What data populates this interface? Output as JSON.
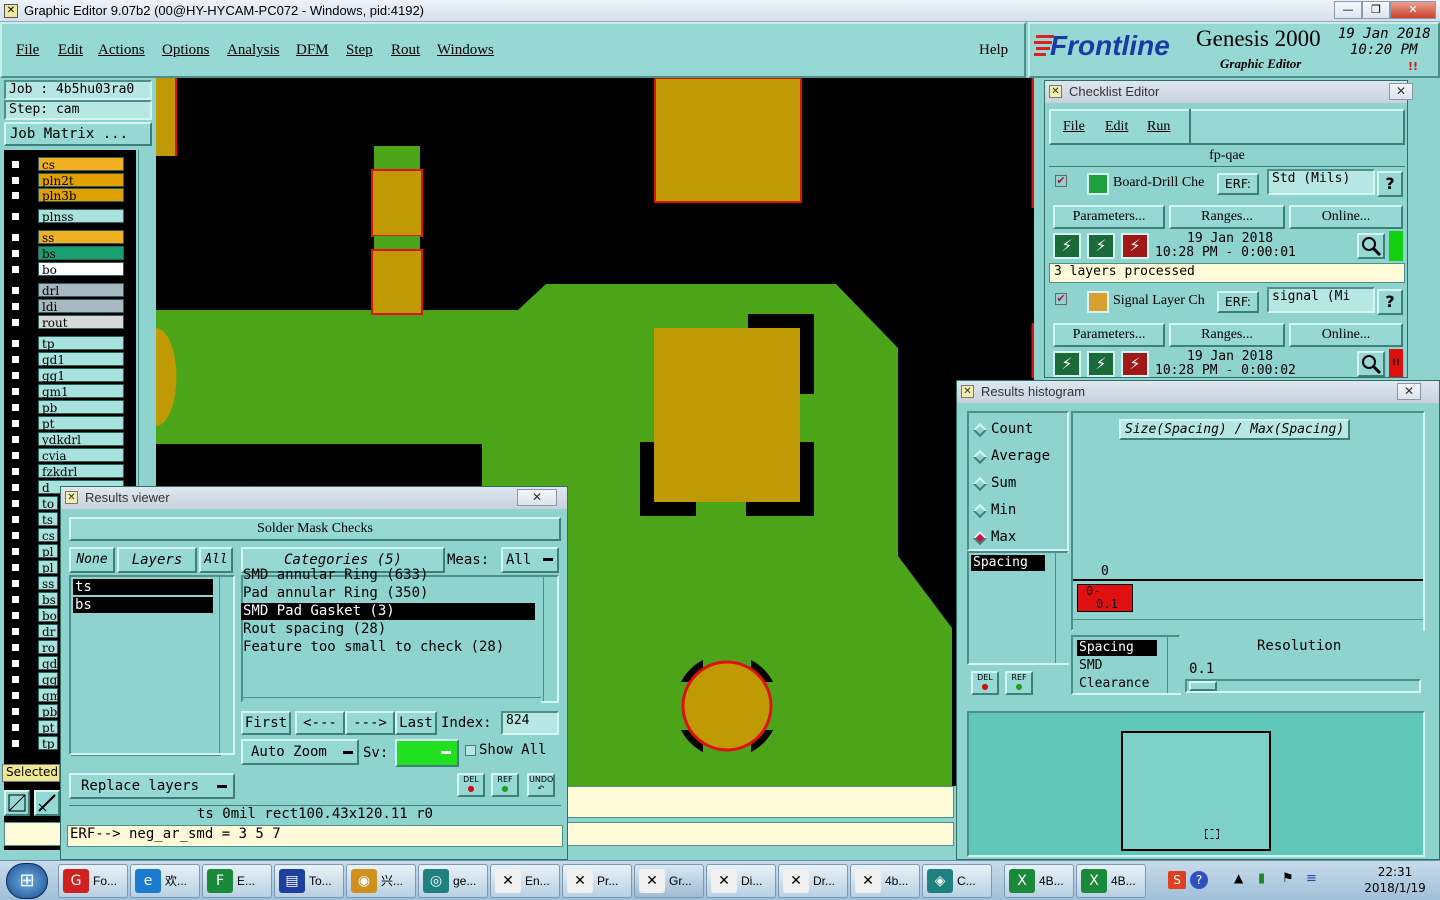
{
  "window": {
    "title": "Graphic Editor 9.07b2 (00@HY-HYCAM-PC072 - Windows, pid:4192)",
    "min": "—",
    "max": "❐",
    "close": "✕"
  },
  "menu": {
    "items": [
      "File",
      "Edit",
      "Actions",
      "Options",
      "Analysis",
      "DFM",
      "Step",
      "Rout",
      "Windows"
    ],
    "help": "Help"
  },
  "brand": {
    "logo": "Frontline",
    "product": "Genesis 2000",
    "subtitle": "Graphic Editor",
    "date": "19 Jan 2018",
    "time": "10:20 PM",
    "alert": "!!"
  },
  "left": {
    "job": "Job : 4b5hu03ra0",
    "step": "Step: cam",
    "job_matrix": "Job Matrix ...",
    "layers_top": [
      {
        "name": "cs",
        "color": "#f0b020"
      },
      {
        "name": "pln2t",
        "color": "#e0a000"
      },
      {
        "name": "pln3b",
        "color": "#e0a000"
      },
      {
        "name": "plnss",
        "color": "#a8e2de"
      },
      {
        "name": "ss",
        "color": "#f0b020"
      },
      {
        "name": "bs",
        "color": "#18a070"
      },
      {
        "name": "bo",
        "color": "#ffffff"
      },
      {
        "name": "drl",
        "color": "#a8b8c0"
      },
      {
        "name": "ldi",
        "color": "#a8b8c0"
      },
      {
        "name": "rout",
        "color": "#d8d8d8"
      },
      {
        "name": "tp",
        "color": "#a8e2de"
      },
      {
        "name": "gd1",
        "color": "#a8e2de"
      },
      {
        "name": "gg1",
        "color": "#a8e2de"
      },
      {
        "name": "gm1",
        "color": "#a8e2de"
      },
      {
        "name": "pb",
        "color": "#a8e2de"
      },
      {
        "name": "pt",
        "color": "#a8e2de"
      },
      {
        "name": "ydkdrl",
        "color": "#a8e2de"
      },
      {
        "name": "cvia",
        "color": "#a8e2de"
      },
      {
        "name": "fzkdrl",
        "color": "#a8e2de"
      },
      {
        "name": "d",
        "color": "#a8e2de"
      }
    ],
    "layers_bottom": [
      "to",
      "ts",
      "cs",
      "pl",
      "pl",
      "ss",
      "bs",
      "bo",
      "dr",
      "ro",
      "gd",
      "gg",
      "gm",
      "pb",
      "pt",
      "tp"
    ],
    "selected": "Selected"
  },
  "results_viewer": {
    "title": "Results viewer",
    "close": "✕",
    "header": "Solder Mask Checks",
    "none": "None",
    "layers": "Layers",
    "all": "All",
    "layer_list": [
      "ts",
      "bs"
    ],
    "categories_label": "Categories (5)",
    "meas_label": "Meas:",
    "meas_value": "All",
    "categories": [
      "SMD annular Ring (633)",
      "Pad annular Ring (350)",
      "SMD Pad Gasket (3)",
      "Rout spacing (28)",
      "Feature too small to check (28)"
    ],
    "first": "First",
    "prev": "<---",
    "next": "--->",
    "last": "Last",
    "index_label": "Index:",
    "index_value": "824",
    "auto_zoom": "Auto Zoom",
    "sv_label": "Sv:",
    "show_all": "Show All",
    "replace_layers": "Replace layers",
    "del": "DEL",
    "ref": "REF",
    "undo": "UNDO",
    "status": "ts 0mil   rect100.43x120.11  r0",
    "erf": "ERF--> neg_ar_smd = 3 5 7"
  },
  "checklist": {
    "title": "Checklist Editor",
    "close": "✕",
    "menu": [
      "File",
      "Edit",
      "Run"
    ],
    "name": "fp-qae",
    "parameters": "Parameters...",
    "ranges": "Ranges...",
    "online": "Online...",
    "erf_label": "ERF:",
    "help": "?",
    "items": [
      {
        "name": "Board-Drill Che",
        "erf": "Std (Mils)",
        "date": "19 Jan 2018",
        "time": "10:28 PM - 0:00:01",
        "status": "3 layers processed"
      },
      {
        "name": "Signal Layer Ch",
        "erf": "signal (Mi",
        "date": "19 Jan 2018",
        "time": "10:28 PM - 0:00:02"
      }
    ]
  },
  "histogram": {
    "title": "Results histogram",
    "close": "✕",
    "radios": [
      "Count",
      "Average",
      "Sum",
      "Min",
      "Max"
    ],
    "selected_radio": "Max",
    "chart_title": "Size(Spacing) / Max(Spacing)",
    "list": [
      "Spacing"
    ],
    "count_label": "0",
    "bar_label_top": "0-",
    "bar_label_bottom": "0.1",
    "attributes": [
      "Spacing",
      "SMD",
      "Clearance"
    ],
    "resolution_label": "Resolution",
    "resolution_value": "0.1",
    "del": "DEL",
    "ref": "REF"
  },
  "taskbar": {
    "buttons": [
      "Fo...",
      "欢...",
      "E...",
      "To...",
      "兴...",
      "ge...",
      "En...",
      "Pr...",
      "Gr...",
      "Di...",
      "Dr...",
      "4b...",
      "C...",
      "4B...",
      "4B..."
    ],
    "clock_time": "22:31",
    "clock_date": "2018/1/19"
  }
}
